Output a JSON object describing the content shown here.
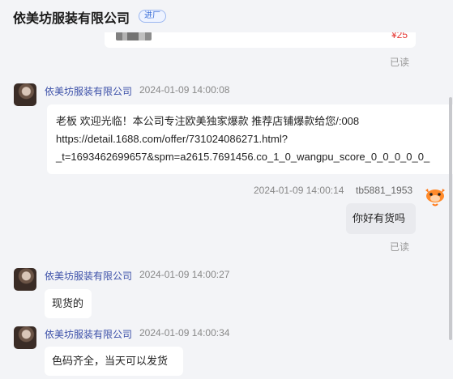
{
  "header": {
    "shop_name": "依美坊服装有限公司",
    "badge": "进厂"
  },
  "top_card": {
    "price": "¥25",
    "read_status": "已读"
  },
  "messages": [
    {
      "sender": "依美坊服装有限公司",
      "time": "2024-01-09 14:00:08",
      "lines": [
        "老板 欢迎光临！本公司专注欧美独家爆款 推荐店铺爆款给您/:008",
        "https://detail.1688.com/offer/731024086271.html?",
        "_t=1693462699657&spm=a2615.7691456.co_1_0_wangpu_score_0_0_0_0_0_"
      ]
    },
    {
      "sender": "tb5881_1953",
      "time": "2024-01-09 14:00:14",
      "text": "你好有货吗",
      "read_status": "已读"
    },
    {
      "sender": "依美坊服装有限公司",
      "time": "2024-01-09 14:00:27",
      "text": "现货的"
    },
    {
      "sender": "依美坊服装有限公司",
      "time": "2024-01-09 14:00:34",
      "text": "色码齐全，当天可以发货"
    }
  ]
}
